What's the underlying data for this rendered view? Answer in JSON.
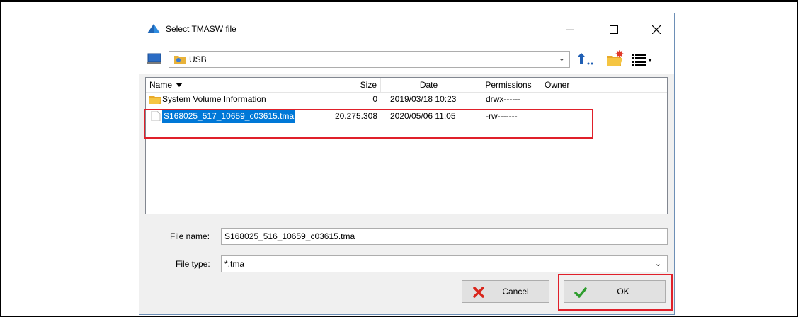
{
  "dialog": {
    "title": "Select TMASW file"
  },
  "toolbar": {
    "path": "USB"
  },
  "filelist": {
    "columns": {
      "name": "Name",
      "size": "Size",
      "date": "Date",
      "permissions": "Permissions",
      "owner": "Owner"
    },
    "rows": [
      {
        "name": "System Volume Information",
        "size": "0",
        "date": "2019/03/18 10:23",
        "permissions": "drwx------",
        "owner": ""
      },
      {
        "name": "S168025_517_10659_c03615.tma",
        "size": "20.275.308",
        "date": "2020/05/06 11:05",
        "permissions": "-rw-------",
        "owner": ""
      }
    ]
  },
  "form": {
    "file_name_label": "File name:",
    "file_name_value": "S168025_516_10659_c03615.tma",
    "file_type_label": "File type:",
    "file_type_value": "*.tma"
  },
  "buttons": {
    "cancel": "Cancel",
    "ok": "OK"
  },
  "colors": {
    "selection": "#0078d7",
    "highlight": "#e0202a",
    "ok_check": "#2e9d2e",
    "cancel_x": "#d9261c"
  }
}
